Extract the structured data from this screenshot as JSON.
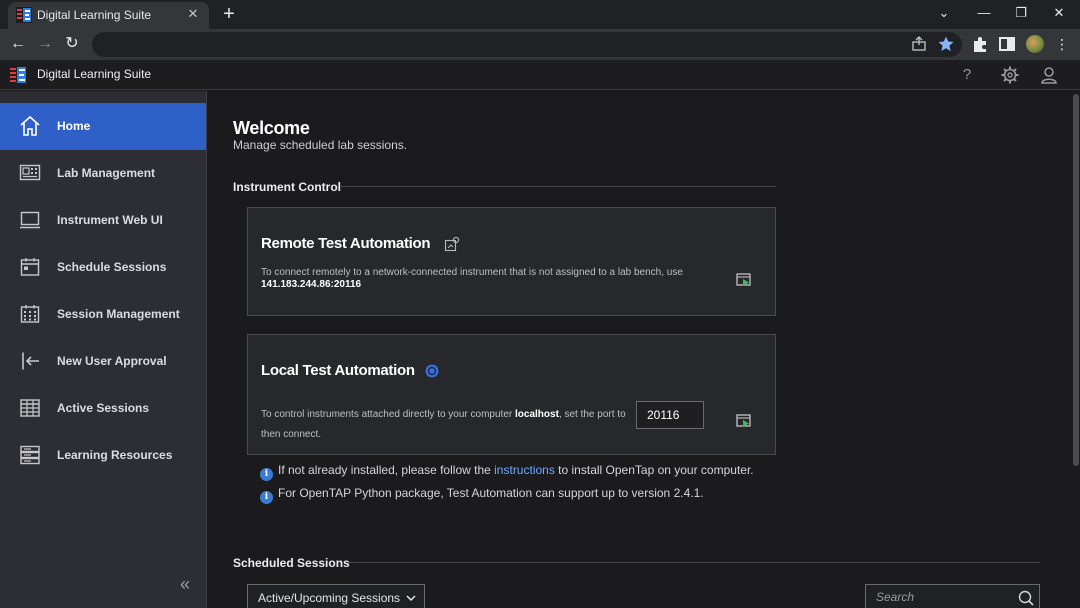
{
  "browser": {
    "tab_title": "Digital Learning Suite",
    "tab_close": "✕",
    "new_tab": "+",
    "window_controls": [
      "⌄",
      "—",
      "❐",
      "✕"
    ],
    "nav": {
      "back": "←",
      "forward": "→",
      "reload": "↻"
    },
    "menu": "⋮"
  },
  "app": {
    "title": "Digital Learning Suite",
    "help": "?",
    "brand_colors": {
      "accent": "#2e60c8",
      "logo_blue": "#2f7de1",
      "logo_red": "#e33b3b"
    }
  },
  "sidebar": {
    "items": [
      {
        "label": "Home",
        "icon": "home-icon",
        "active": true
      },
      {
        "label": "Lab Management",
        "icon": "lab-management-icon"
      },
      {
        "label": "Instrument Web UI",
        "icon": "monitor-icon"
      },
      {
        "label": "Schedule Sessions",
        "icon": "calendar-icon"
      },
      {
        "label": "Session Management",
        "icon": "calendar-grid-icon"
      },
      {
        "label": "New User Approval",
        "icon": "login-arrow-icon"
      },
      {
        "label": "Active Sessions",
        "icon": "table-icon"
      },
      {
        "label": "Learning Resources",
        "icon": "server-stack-icon"
      }
    ],
    "collapse": "«"
  },
  "main": {
    "title": "Welcome",
    "subtitle": "Manage scheduled lab sessions.",
    "instrument_control": {
      "heading": "Instrument Control",
      "remote": {
        "title": "Remote Test Automation",
        "text": "To connect remotely to a network-connected instrument that is not assigned to a lab bench, use",
        "address": "141.183.244.86:20116"
      },
      "local": {
        "title": "Local Test Automation",
        "text_before": "To control instruments attached directly to your computer",
        "host": "localhost",
        "text_after": ", set the port to",
        "text_line2": "then connect.",
        "port": "20116"
      },
      "info": [
        {
          "before": "If not already installed, please follow the ",
          "link": "instructions",
          "after": " to install OpenTap on your computer."
        },
        {
          "text": "For OpenTAP Python package, Test Automation can support up to version 2.4.1."
        }
      ],
      "info_glyph": "i"
    },
    "scheduled_sessions": {
      "heading": "Scheduled Sessions",
      "filter_selected": "Active/Upcoming Sessions",
      "search_placeholder": "Search"
    }
  }
}
